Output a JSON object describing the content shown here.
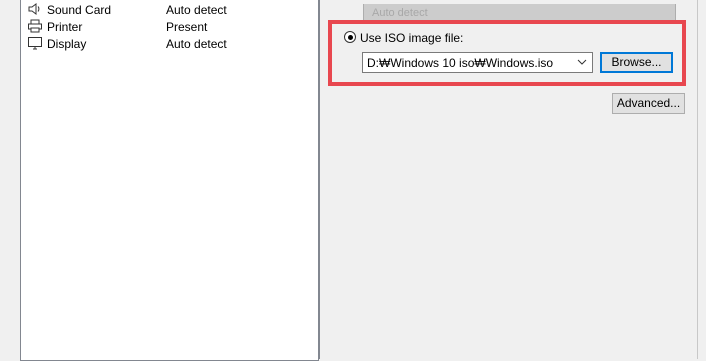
{
  "hardware_list": [
    {
      "name": "Sound Card",
      "summary": "Auto detect",
      "icon": "speaker-icon"
    },
    {
      "name": "Printer",
      "summary": "Present",
      "icon": "printer-icon"
    },
    {
      "name": "Display",
      "summary": "Auto detect",
      "icon": "monitor-icon"
    }
  ],
  "cdrom": {
    "disabled_field_text": "Auto detect",
    "iso_option_label": "Use ISO image file:",
    "iso_path": "D:₩Windows 10 iso₩Windows.iso",
    "browse_label": "Browse...",
    "advanced_label": "Advanced...",
    "iso_selected": true
  },
  "colors": {
    "highlight": "#e8474f",
    "focus_border": "#0078d7"
  }
}
